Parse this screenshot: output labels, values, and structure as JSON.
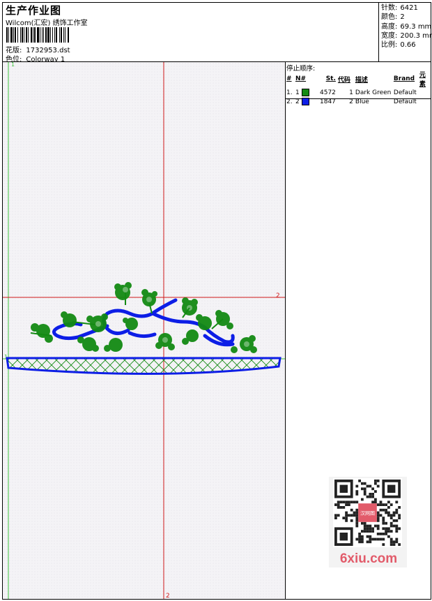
{
  "header": {
    "title": "生产作业图",
    "company": "Wilcom(汇宏) 绣饰工作室",
    "design_label": "花版:",
    "design_file": "1732953.dst",
    "colorway_label": "色位:",
    "colorway": "Colorway 1"
  },
  "stats": [
    {
      "label": "针数:",
      "value": "6421"
    },
    {
      "label": "颜色:",
      "value": "2"
    },
    {
      "label": "高度:",
      "value": "69.3 mm"
    },
    {
      "label": "宽度:",
      "value": "200.3 mm"
    },
    {
      "label": "比例:",
      "value": "0.66"
    }
  ],
  "stop_sequence": {
    "title": "停止顺序:",
    "columns": [
      "#",
      "N#",
      "St.",
      "代码",
      "描述",
      "Brand",
      "元素"
    ],
    "rows": [
      {
        "index": "1.",
        "needle": "1",
        "color": "#138a13",
        "stitches": "4572",
        "code": "1",
        "description": "Dark Green",
        "brand": "Default"
      },
      {
        "index": "2.",
        "needle": "2",
        "color": "#0d1ee6",
        "stitches": "1847",
        "code": "2",
        "description": "Blue",
        "brand": "Default"
      }
    ]
  },
  "canvas": {
    "marker_top": "1",
    "marker_left": "1",
    "marker_right": "2",
    "marker_bottom": "2"
  },
  "watermark": {
    "seal_text": "汉网图",
    "site": "6xiu.com"
  },
  "colors": {
    "green_thread": "#138a13",
    "blue_thread": "#0d1ee6",
    "red_guide": "#d01a1a",
    "green_guide": "#3ec43e"
  }
}
